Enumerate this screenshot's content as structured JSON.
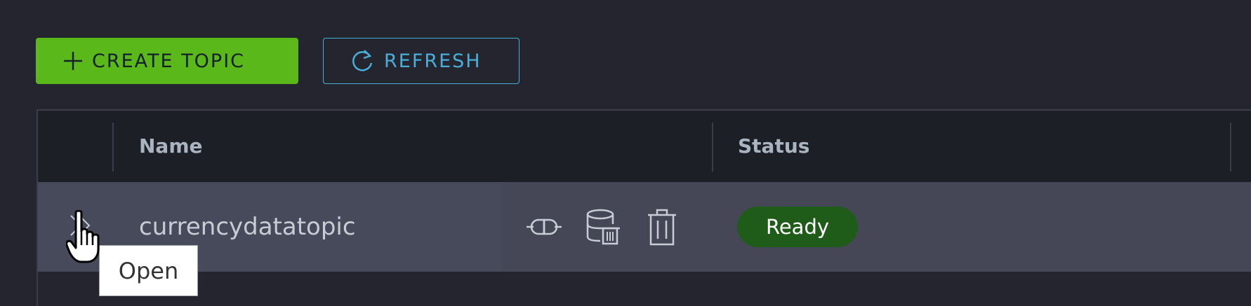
{
  "toolbar": {
    "create_label": "CREATE TOPIC",
    "refresh_label": "REFRESH"
  },
  "table": {
    "columns": [
      "Name",
      "Status"
    ],
    "rows": [
      {
        "name": "currencydatatopic",
        "status": "Ready"
      }
    ]
  },
  "tooltip": "Open",
  "colors": {
    "background": "#24252f",
    "primary": "#5bb81a",
    "accent": "#49afd9",
    "status_ready": "#1f5c1a"
  },
  "icons": {
    "create": "plus-icon",
    "refresh": "refresh-icon",
    "expand": "double-chevron-right-icon",
    "connect": "connector-icon",
    "purge": "database-delete-icon",
    "delete": "trash-icon"
  }
}
